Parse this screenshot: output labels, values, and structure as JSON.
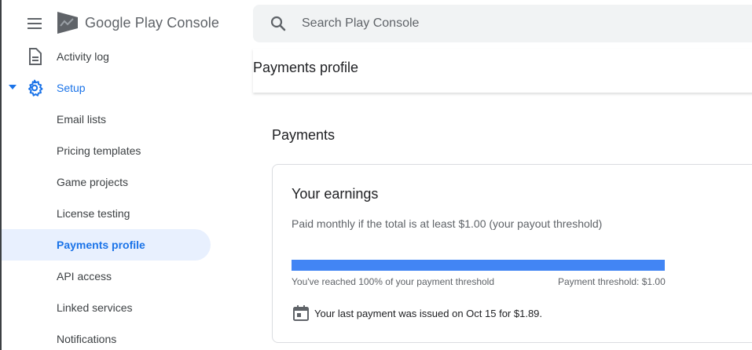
{
  "app": {
    "logo_brand": "Google Play",
    "logo_product": "Console"
  },
  "search": {
    "placeholder": "Search Play Console"
  },
  "sidebar": {
    "items": [
      {
        "label": "Activity log",
        "icon": "document-icon"
      },
      {
        "label": "Setup",
        "icon": "gear-icon",
        "expanded": true
      },
      {
        "label": "Email lists"
      },
      {
        "label": "Pricing templates"
      },
      {
        "label": "Game projects"
      },
      {
        "label": "License testing"
      },
      {
        "label": "Payments profile",
        "selected": true
      },
      {
        "label": "API access"
      },
      {
        "label": "Linked services"
      },
      {
        "label": "Notifications"
      }
    ]
  },
  "page": {
    "title": "Payments profile",
    "section_title": "Payments"
  },
  "earnings": {
    "title": "Your earnings",
    "description": "Paid monthly if the total is at least $1.00 (your payout threshold)",
    "progress_fraction": 1.0,
    "progress_text": "You've reached 100% of your payment threshold",
    "threshold_text": "Payment threshold: $1.00",
    "last_payment_text": "Your last payment was issued on Oct 15 for $1.89."
  },
  "colors": {
    "accent": "#1a73e8",
    "progress": "#4285f4",
    "selected_bg": "#e8f0fe"
  }
}
